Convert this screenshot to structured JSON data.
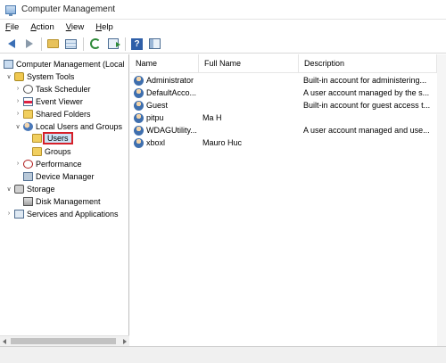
{
  "window": {
    "title": "Computer Management",
    "icon": "computer-management-icon"
  },
  "menu": [
    {
      "label": "File",
      "accel": "F",
      "rest": "ile"
    },
    {
      "label": "Action",
      "accel": "A",
      "rest": "ction"
    },
    {
      "label": "View",
      "accel": "V",
      "rest": "iew"
    },
    {
      "label": "Help",
      "accel": "H",
      "rest": "elp"
    }
  ],
  "toolbar": {
    "buttons": [
      "back-arrow-icon",
      "forward-arrow-icon",
      "up-folder-icon",
      "show-hide-tree-icon",
      "refresh-icon",
      "export-list-icon",
      "help-icon",
      "console-tree-icon"
    ]
  },
  "tree": {
    "root": "Computer Management (Local",
    "system_tools": "System Tools",
    "task_scheduler": "Task Scheduler",
    "event_viewer": "Event Viewer",
    "shared_folders": "Shared Folders",
    "local_users_groups": "Local Users and Groups",
    "users": "Users",
    "groups": "Groups",
    "performance": "Performance",
    "device_manager": "Device Manager",
    "storage": "Storage",
    "disk_management": "Disk Management",
    "services_apps": "Services and Applications"
  },
  "list": {
    "columns": {
      "name": "Name",
      "full_name": "Full Name",
      "description": "Description"
    },
    "rows": [
      {
        "name": "Administrator",
        "full_name": "",
        "description": "Built-in account for administering..."
      },
      {
        "name": "DefaultAcco...",
        "full_name": "",
        "description": "A user account managed by the s..."
      },
      {
        "name": "Guest",
        "full_name": "",
        "description": "Built-in account for guest access t..."
      },
      {
        "name": "pitpu",
        "full_name": "Ma H",
        "description": ""
      },
      {
        "name": "WDAGUtility...",
        "full_name": "",
        "description": "A user account managed and use..."
      },
      {
        "name": "xboxl",
        "full_name": "Mauro Huc",
        "description": ""
      }
    ]
  },
  "colors": {
    "selection_highlight": "#cce4f7",
    "selection_border": "#d6202a",
    "help_blue": "#2f5fa8"
  }
}
